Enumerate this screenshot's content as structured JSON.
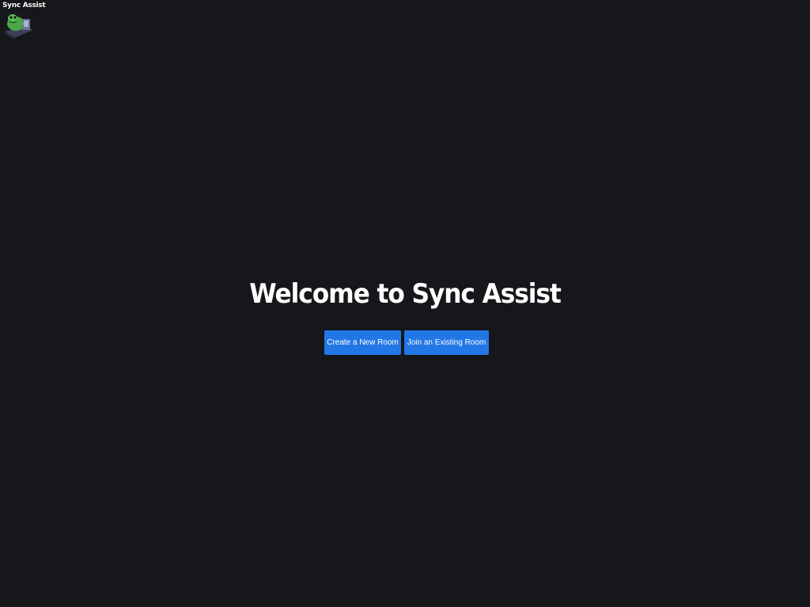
{
  "app": {
    "logo_text": "Sync Assist"
  },
  "hero": {
    "title": "Welcome to Sync Assist"
  },
  "actions": {
    "create_label": "Create a New Room",
    "join_label": "Join an Existing Room"
  },
  "colors": {
    "background": "#16171b",
    "button": "#2277e6",
    "text": "#ffffff"
  }
}
